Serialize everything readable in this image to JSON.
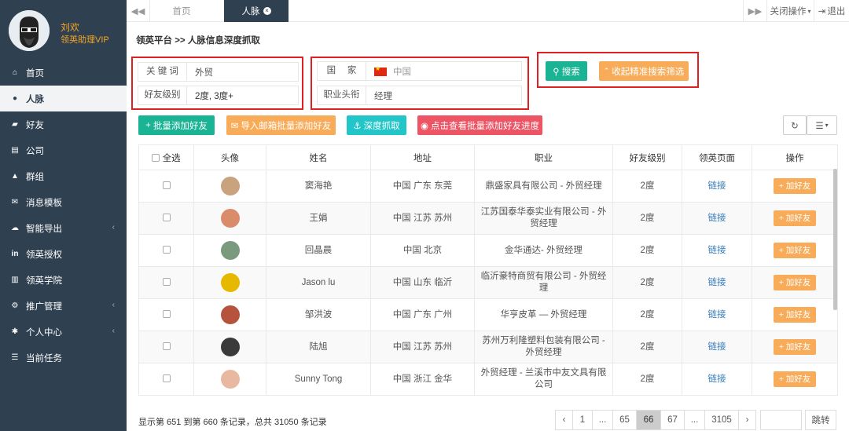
{
  "sidebar": {
    "user": {
      "name": "刘欢",
      "role": "领英助理VIP"
    },
    "items": [
      {
        "label": "首页",
        "icon": "home-icon"
      },
      {
        "label": "人脉",
        "icon": "user-icon"
      },
      {
        "label": "好友",
        "icon": "chat-icon"
      },
      {
        "label": "公司",
        "icon": "briefcase-icon"
      },
      {
        "label": "群组",
        "icon": "group-icon"
      },
      {
        "label": "消息模板",
        "icon": "mail-icon"
      },
      {
        "label": "智能导出",
        "icon": "cloud-upload-icon"
      },
      {
        "label": "领英授权",
        "icon": "linkedin-icon"
      },
      {
        "label": "领英学院",
        "icon": "bank-icon"
      },
      {
        "label": "推广管理",
        "icon": "gear-icon"
      },
      {
        "label": "个人中心",
        "icon": "cog-icon"
      },
      {
        "label": "当前任务",
        "icon": "list-icon"
      }
    ]
  },
  "topbar": {
    "back": "◀◀",
    "tab_home": "首页",
    "tab_people": "人脉",
    "close_ops": "关闭操作",
    "logout": "退出",
    "fwd": "▶▶"
  },
  "breadcrumb": {
    "root": "领英平台",
    "sep": ">>",
    "current": "人脉信息深度抓取"
  },
  "filters": {
    "keyword_label": "关 键 词",
    "keyword": "外贸",
    "level_label": "好友级别",
    "level": "2度, 3度+",
    "country_label": "国　 家",
    "country": "中国",
    "title_label": "职业头衔",
    "title": "经理"
  },
  "buttons": {
    "search": "搜索",
    "collapse": "收起精准搜索筛选",
    "batch_add": "批量添加好友",
    "import_email": "导入邮箱批量添加好友",
    "deep": "深度抓取",
    "progress": "点击查看批量添加好友进度"
  },
  "table": {
    "headers": [
      "全选",
      "头像",
      "姓名",
      "地址",
      "职业",
      "好友级别",
      "领英页面",
      "操作"
    ],
    "link_text": "链接",
    "add_text": "加好友",
    "rows": [
      {
        "name": "窦海艳",
        "addr": "中国 广东 东莞",
        "job": "鼎盛家具有限公司 - 外贸经理",
        "level": "2度"
      },
      {
        "name": "王娟",
        "addr": "中国 江苏 苏州",
        "job": "江苏国泰华泰实业有限公司 - 外贸经理",
        "level": "2度"
      },
      {
        "name": "回晶晨",
        "addr": "中国 北京",
        "job": "金华通达- 外贸经理",
        "level": "2度"
      },
      {
        "name": "Jason lu",
        "addr": "中国 山东 临沂",
        "job": "临沂豪特商贸有限公司 - 外贸经理",
        "level": "2度"
      },
      {
        "name": "邹洪波",
        "addr": "中国 广东 广州",
        "job": "华亨皮革 — 外贸经理",
        "level": "2度"
      },
      {
        "name": "陆旭",
        "addr": "中国 江苏 苏州",
        "job": "苏州万利隆塑料包装有限公司 - 外贸经理",
        "level": "2度"
      },
      {
        "name": "Sunny Tong",
        "addr": "中国 浙江 金华",
        "job": "外贸经理 - 兰溪市中友文具有限公司",
        "level": "2度"
      }
    ]
  },
  "footer": {
    "summary": "显示第 651 到第 660 条记录，总共 31050 条记录"
  },
  "pager": {
    "prev": "‹",
    "p1": "1",
    "dots1": "...",
    "p65": "65",
    "p66": "66",
    "p67": "67",
    "dots2": "...",
    "last": "3105",
    "next": "›",
    "go": "跳转"
  },
  "colors": {
    "sidebar": "#2f4050",
    "accent": "#1ab394",
    "orange": "#f8ac59",
    "highlight_box": "#e02020"
  }
}
